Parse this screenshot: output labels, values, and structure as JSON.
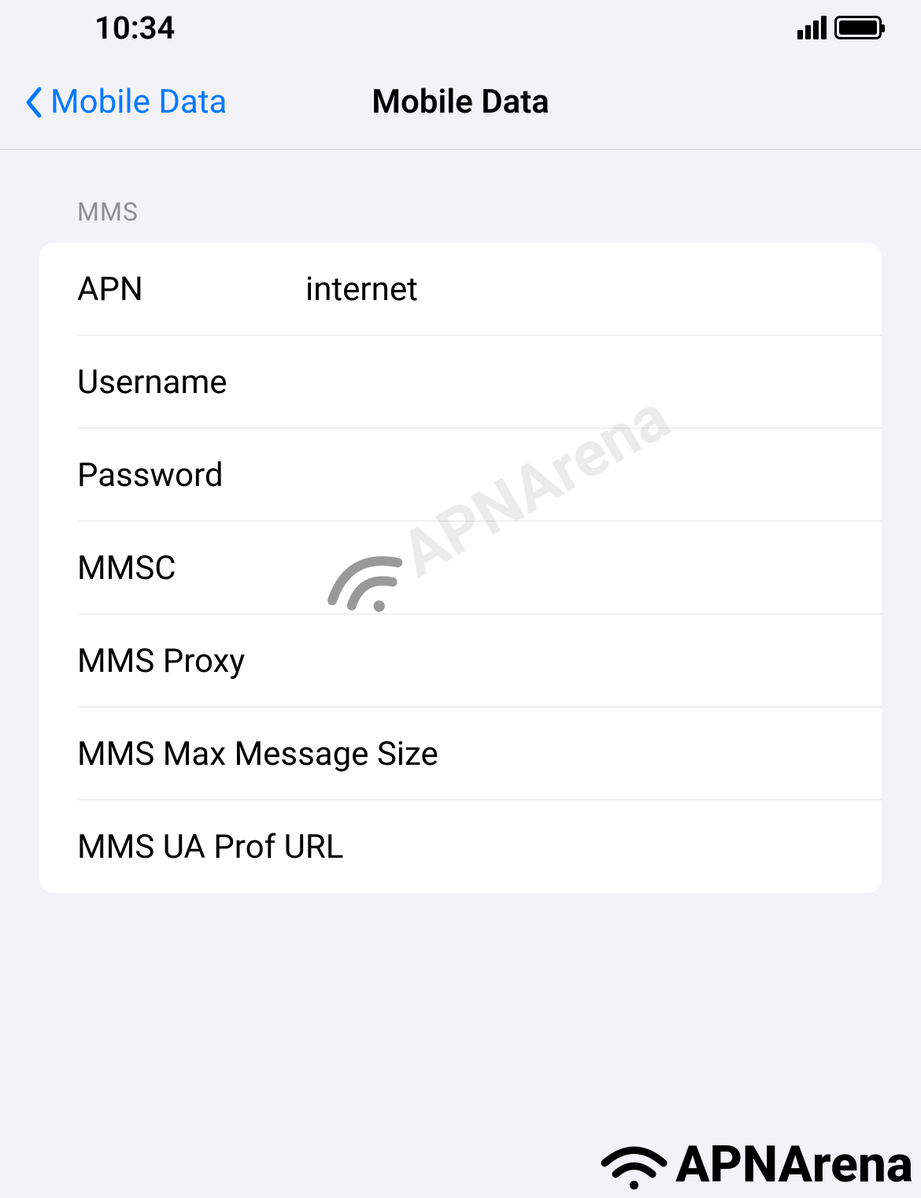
{
  "statusBar": {
    "time": "10:34"
  },
  "nav": {
    "backLabel": "Mobile Data",
    "title": "Mobile Data"
  },
  "section": {
    "header": "MMS",
    "rows": [
      {
        "label": "APN",
        "value": "internet"
      },
      {
        "label": "Username",
        "value": ""
      },
      {
        "label": "Password",
        "value": ""
      },
      {
        "label": "MMSC",
        "value": ""
      },
      {
        "label": "MMS Proxy",
        "value": ""
      },
      {
        "label": "MMS Max Message Size",
        "value": ""
      },
      {
        "label": "MMS UA Prof URL",
        "value": ""
      }
    ]
  },
  "watermark": "APNArena",
  "logo": "APNArena"
}
